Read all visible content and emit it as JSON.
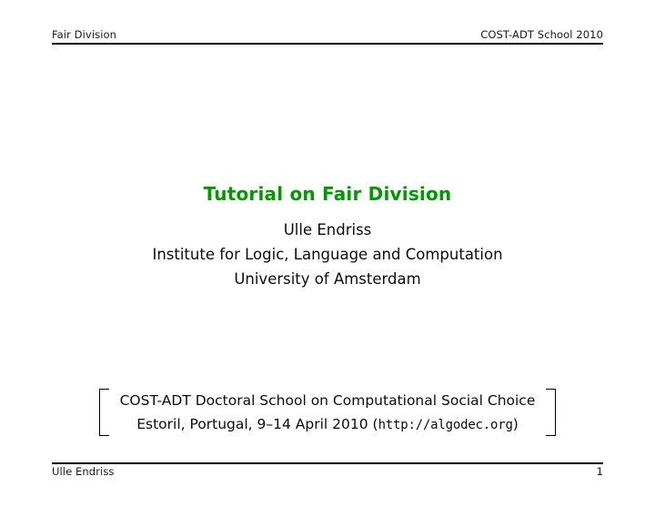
{
  "slide": {
    "background_color": "#ffffff",
    "title_color": "#009900"
  },
  "header": {
    "left": "Fair Division",
    "right": "COST-ADT School 2010"
  },
  "title": {
    "text": "Tutorial on Fair Division"
  },
  "authors": {
    "lines": [
      "Ulle Endriss",
      "Institute for Logic, Language and Computation",
      "University of Amsterdam"
    ]
  },
  "event": {
    "line1": "COST-ADT Doctoral School on Computational Social Choice",
    "line2_prefix": "Estoril, Portugal, 9–14 April 2010 (",
    "line2_url": "http://algodec.org",
    "line2_suffix": ")"
  },
  "footer": {
    "left": "Ulle Endriss",
    "page": "1"
  }
}
